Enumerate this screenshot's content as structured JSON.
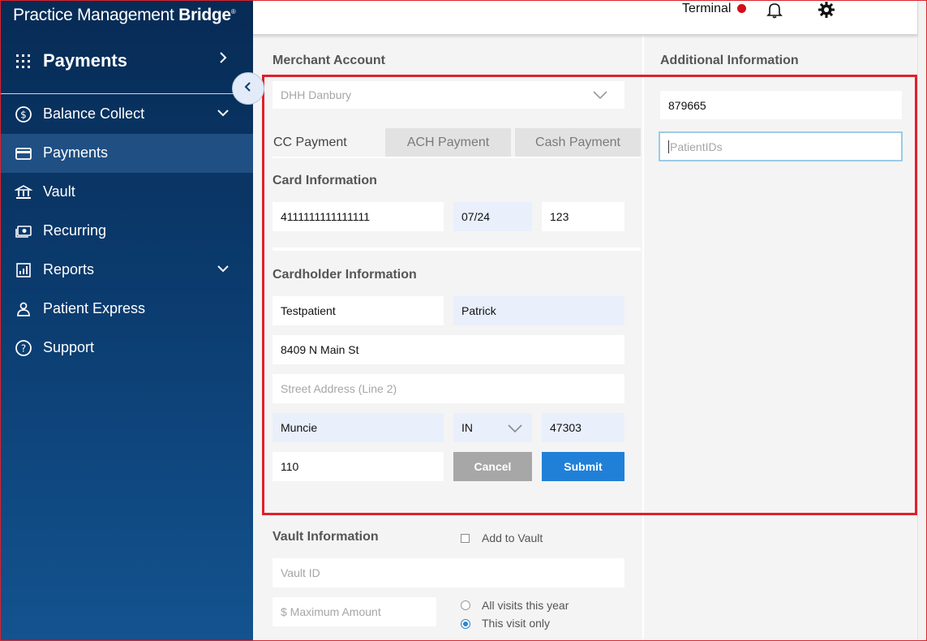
{
  "sidebar": {
    "brand_regular": "Practice Management ",
    "brand_bold": "Bridge",
    "brand_mark": "®",
    "module_title": "Payments",
    "items": [
      {
        "label": "Balance Collect",
        "icon": "dollar-circle-icon",
        "has_submenu": true
      },
      {
        "label": "Payments",
        "icon": "credit-card-icon",
        "active": true
      },
      {
        "label": "Vault",
        "icon": "bank-icon"
      },
      {
        "label": "Recurring",
        "icon": "cash-icon"
      },
      {
        "label": "Reports",
        "icon": "report-chart-icon",
        "has_submenu": true
      },
      {
        "label": "Patient Express",
        "icon": "person-icon"
      },
      {
        "label": "Support",
        "icon": "help-circle-icon"
      }
    ]
  },
  "header": {
    "terminal_label": "Terminal",
    "terminal_status_color": "#d0101b"
  },
  "merchant": {
    "section_label": "Merchant Account",
    "selected": "DHH Danbury"
  },
  "tabs": [
    {
      "label": "CC Payment",
      "active": true
    },
    {
      "label": "ACH Payment"
    },
    {
      "label": "Cash Payment"
    }
  ],
  "card": {
    "section_label": "Card Information",
    "number": "4111111111111111",
    "expiry": "07/24",
    "cvv": "123"
  },
  "cardholder": {
    "section_label": "Cardholder Information",
    "last_name": "Testpatient",
    "first_name": "Patrick",
    "address1": "8409 N Main St",
    "address2_placeholder": "Street Address (Line 2)",
    "city": "Muncie",
    "state": "IN",
    "zip": "47303",
    "amount": "110"
  },
  "actions": {
    "cancel": "Cancel",
    "submit": "Submit"
  },
  "vault": {
    "section_label": "Vault Information",
    "add_to_vault": "Add to Vault",
    "add_to_vault_checked": false,
    "vault_id_placeholder": "Vault ID",
    "max_amount_placeholder": "$ Maximum Amount",
    "options": [
      "All visits this year",
      "This visit only"
    ],
    "selected_option": "This visit only"
  },
  "additional": {
    "section_label": "Additional Information",
    "account_number": "879665",
    "patient_ids_placeholder": "PatientIDs"
  },
  "colors": {
    "accent": "#2080d8",
    "highlight_box": "#e0202b",
    "sidebar": "#0b3b6e"
  }
}
